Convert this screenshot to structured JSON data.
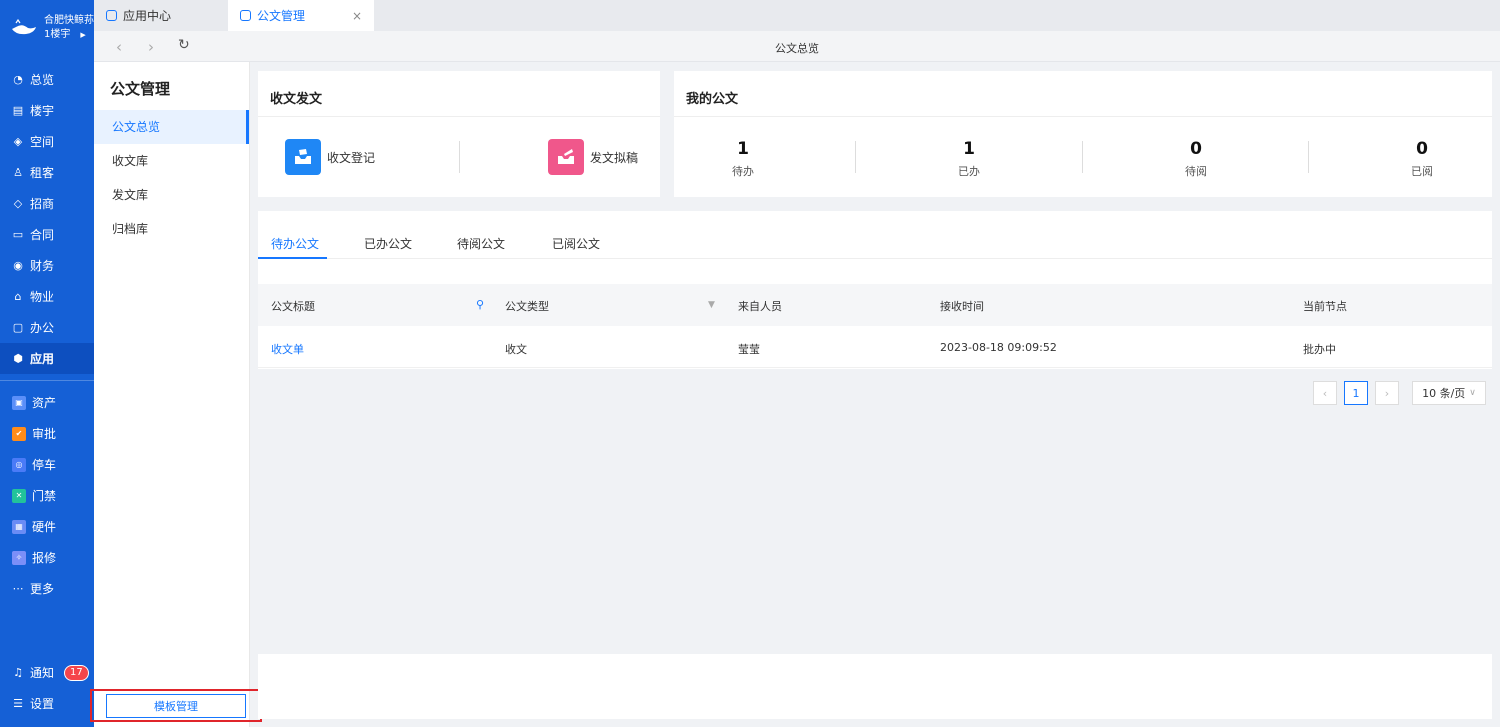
{
  "brand": {
    "name": "合肥快鲸荪",
    "location": "1楼宇"
  },
  "nav": {
    "items": [
      {
        "label": "总览",
        "icon": "dashboard-icon"
      },
      {
        "label": "楼宇",
        "icon": "building-icon"
      },
      {
        "label": "空间",
        "icon": "cube-icon"
      },
      {
        "label": "租客",
        "icon": "users-icon"
      },
      {
        "label": "招商",
        "icon": "tag-icon"
      },
      {
        "label": "合同",
        "icon": "document-icon"
      },
      {
        "label": "财务",
        "icon": "money-icon"
      },
      {
        "label": "物业",
        "icon": "home-icon"
      },
      {
        "label": "办公",
        "icon": "monitor-icon"
      },
      {
        "label": "应用",
        "icon": "app-icon"
      }
    ],
    "apps": [
      {
        "label": "资产",
        "color": "#5b8ff9"
      },
      {
        "label": "审批",
        "color": "#ff8c1a"
      },
      {
        "label": "停车",
        "color": "#4a7bf7"
      },
      {
        "label": "门禁",
        "color": "#22c39a"
      },
      {
        "label": "硬件",
        "color": "#6a8cf5"
      },
      {
        "label": "报修",
        "color": "#7b8ff8"
      }
    ],
    "more": "更多",
    "notify": "通知",
    "notify_count": "17",
    "settings": "设置"
  },
  "tabs": [
    {
      "label": "应用中心"
    },
    {
      "label": "公文管理"
    }
  ],
  "close_glyph": "×",
  "address": {
    "title": "公文总览"
  },
  "subnav": {
    "title": "公文管理",
    "items": [
      "公文总览",
      "收文库",
      "发文库",
      "归档库"
    ],
    "template_button": "模板管理"
  },
  "send_receive": {
    "title": "收文发文",
    "receive": "收文登记",
    "send": "发文拟稿"
  },
  "my_docs": {
    "title": "我的公文",
    "stats": [
      {
        "value": "1",
        "label": "待办"
      },
      {
        "value": "1",
        "label": "已办"
      },
      {
        "value": "0",
        "label": "待阅"
      },
      {
        "value": "0",
        "label": "已阅"
      }
    ]
  },
  "list_tabs": [
    "待办公文",
    "已办公文",
    "待阅公文",
    "已阅公文"
  ],
  "table": {
    "columns": [
      "公文标题",
      "公文类型",
      "来自人员",
      "接收时间",
      "当前节点"
    ],
    "rows": [
      {
        "title": "收文单",
        "type": "收文",
        "from": "莹莹",
        "time": "2023-08-18 09:09:52",
        "node": "批办中"
      }
    ]
  },
  "pagination": {
    "current": "1",
    "page_size": "10 条/页"
  },
  "colors": {
    "primary": "#1677ff",
    "nav_bg": "#1560d6",
    "highlight": "#e0252b"
  }
}
